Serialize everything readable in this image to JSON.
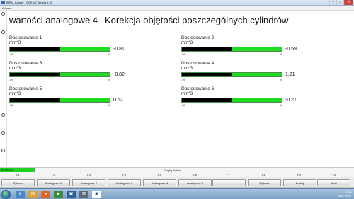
{
  "window": {
    "title": "BIPA - Loader - SCE-V2 Wersja 1.39",
    "controls": {
      "minimize": "–",
      "maximize": "□",
      "close": "✕"
    }
  },
  "menu": {
    "item": "Arkusz..."
  },
  "header": {
    "title": "wartości analogowe 4",
    "subtitle": "Korekcja objętości poszczególnych cylindrów"
  },
  "gauges": [
    {
      "label": "Dostosowanie 1",
      "unit": "mm^3",
      "value": "-0.81",
      "min": "-99",
      "max": "99",
      "fill_fraction": 0.5
    },
    {
      "label": "Dostosowanie 2",
      "unit": "mm^3",
      "value": "-0.59",
      "min": "-99",
      "max": "99",
      "fill_fraction": 0.5
    },
    {
      "label": "Dostosowanie 3",
      "unit": "mm^3",
      "value": "-0.82",
      "min": "-99",
      "max": "99",
      "fill_fraction": 0.5
    },
    {
      "label": "Dostosowanie 4",
      "unit": "mm^3",
      "value": "1.21",
      "min": "-99",
      "max": "99",
      "fill_fraction": 0.5
    },
    {
      "label": "Dostosowanie 5",
      "unit": "mm^3",
      "value": "0.62",
      "min": "-99",
      "max": "99",
      "fill_fraction": 0.5
    },
    {
      "label": "Dostosowanie 6",
      "unit": "mm^3",
      "value": "-0.21",
      "min": "-99",
      "max": "99",
      "fill_fraction": 0.5
    }
  ],
  "status": {
    "left": "ECMN0A1",
    "center": "Czytaj status"
  },
  "fkeys": [
    "F1",
    "F2",
    "F3",
    "F4",
    "F5",
    "F6",
    "F7",
    "F8",
    "F9",
    "F10"
  ],
  "buttons": [
    "Cykowe",
    "Analogowe 1",
    "Analogowe 2",
    "Analogowe 3",
    "Analogowe 4",
    "Analogowe 5",
    "",
    "Wybierz",
    "Drukuj",
    "Wróć"
  ],
  "taskbar": {
    "time": "10:21",
    "date": "2012-09-17"
  },
  "colors": {
    "gauge_fill": "#21dd21",
    "gauge_indicator": "#000000",
    "status_green": "#1ed11e"
  }
}
